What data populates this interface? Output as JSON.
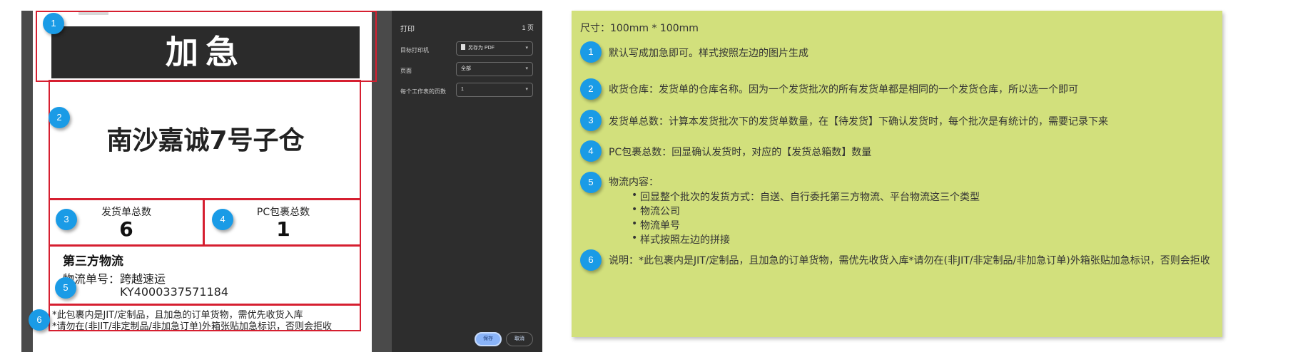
{
  "label": {
    "urgent_text": "加急",
    "warehouse": "南沙嘉诚7号子仓",
    "shipment_count_label": "发货单总数",
    "shipment_count_value": "6",
    "package_count_label": "PC包裹总数",
    "package_count_value": "1",
    "logistics_title": "第三方物流",
    "tracking_label": "物流单号：",
    "carrier": "跨越速运",
    "tracking_number": "KY4000337571184",
    "notice_line1": "*此包裹内是JIT/定制品，且加急的订单货物，需优先收货入库",
    "notice_line2": "*请勿在(非JIT/非定制品/非加急订单)外箱张贴加急标识，否则会拒收"
  },
  "badges": [
    "1",
    "2",
    "3",
    "4",
    "5",
    "6"
  ],
  "print_panel": {
    "title": "打印",
    "pages": "1 页",
    "destination_label": "目标打印机",
    "destination_value": "另存为 PDF",
    "pages_label": "页面",
    "pages_value": "全部",
    "per_sheet_label": "每个工作表的页数",
    "per_sheet_value": "1",
    "save_button": "保存",
    "cancel_button": "取消"
  },
  "spec": {
    "size": "尺寸：100mm * 100mm",
    "item1": "默认写成加急即可。样式按照左边的图片生成",
    "item2": "收货仓库：发货单的仓库名称。因为一个发货批次的所有发货单都是相同的一个发货仓库，所以选一个即可",
    "item3": "发货单总数：计算本发货批次下的发货单数量，在【待发货】下确认发货时，每个批次是有统计的，需要记录下来",
    "item4": "PC包裹总数：回显确认发货时，对应的【发货总箱数】数量",
    "item5_title": "物流内容：",
    "item5_bullets": [
      "回显整个批次的发货方式：自送、自行委托第三方物流、平台物流这三个类型",
      "物流公司",
      "物流单号",
      "样式按照左边的拼接"
    ],
    "item6": "说明：*此包裹内是JIT/定制品，且加急的订单货物，需优先收货入库*请勿在(非JIT/非定制品/非加急订单)外箱张贴加急标识，否则会拒收"
  },
  "colors": {
    "annotation_red": "#d61f30",
    "badge_blue": "#1a9be6",
    "note_green": "#d2e07c",
    "panel_dark": "#2d2d2d"
  }
}
